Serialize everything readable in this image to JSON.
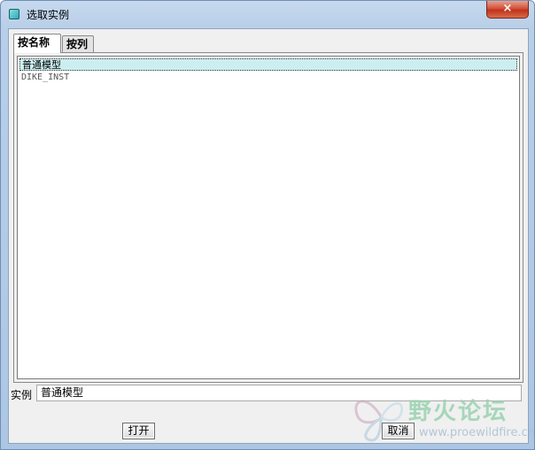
{
  "window": {
    "title": "选取实例",
    "close_glyph": "×"
  },
  "tabs": [
    {
      "label": "按名称",
      "active": true
    },
    {
      "label": "按列",
      "active": false
    }
  ],
  "list": {
    "items": [
      {
        "label": "普通模型",
        "selected": true
      },
      {
        "label": "DIKE_INST",
        "selected": false
      }
    ]
  },
  "instance_field": {
    "label": "实例",
    "value": "普通模型"
  },
  "buttons": {
    "open": "打开",
    "cancel": "取消"
  },
  "watermark": {
    "title": "野火论坛",
    "url": "www.proewildfire.cn"
  },
  "colors": {
    "selection": "#cdeef0",
    "close_button": "#c1321b",
    "watermark": "#9ad2b0"
  },
  "icons": {
    "app": "app-window-icon",
    "close": "close-icon",
    "watermark_logo": "butterfly-logo"
  }
}
